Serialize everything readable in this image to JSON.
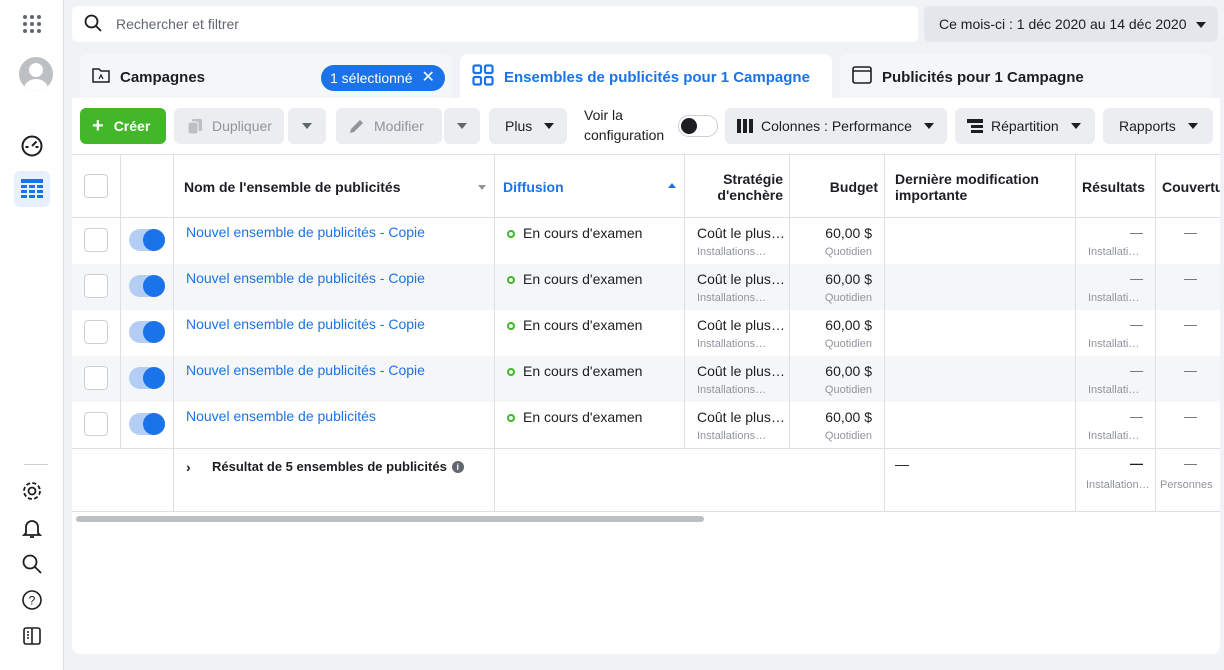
{
  "search": {
    "placeholder": "Rechercher et filtrer"
  },
  "date_range": {
    "label": "Ce mois-ci : 1 déc 2020 au 14 déc 2020"
  },
  "tabs": {
    "campagnes": {
      "label": "Campagnes",
      "badge": "1 sélectionné"
    },
    "ensembles": {
      "label": "Ensembles de publicités pour 1 Campagne"
    },
    "publicites": {
      "label": "Publicités pour 1 Campagne"
    }
  },
  "toolbar": {
    "create": "Créer",
    "duplicate": "Dupliquer",
    "modify": "Modifier",
    "more": "Plus",
    "view_config": "Voir la configuration",
    "columns": "Colonnes : Performance",
    "breakdown": "Répartition",
    "reports": "Rapports"
  },
  "table": {
    "headers": {
      "name": "Nom de l'ensemble de publicités",
      "diffusion": "Diffusion",
      "strategy": "Stratégie d'enchère",
      "budget": "Budget",
      "last_modified": "Dernière modification importante",
      "results": "Résultats",
      "reach": "Couvertu"
    },
    "rows": [
      {
        "name": "Nouvel ensemble de publicités - Copie",
        "status": "En cours d'examen",
        "strategy": "Coût le plus faible",
        "strategy_sub": "Installations de l'application",
        "budget": "60,00 $",
        "budget_sub": "Quotidien",
        "results": "—",
        "results_sub": "Installations de l'application",
        "reach": "—",
        "active": true
      },
      {
        "name": "Nouvel ensemble de publicités - Copie",
        "status": "En cours d'examen",
        "strategy": "Coût le plus faible",
        "strategy_sub": "Installations de l'application",
        "budget": "60,00 $",
        "budget_sub": "Quotidien",
        "results": "—",
        "results_sub": "Installations de l'application",
        "reach": "—",
        "active": true
      },
      {
        "name": "Nouvel ensemble de publicités - Copie",
        "status": "En cours d'examen",
        "strategy": "Coût le plus faible",
        "strategy_sub": "Installations de l'application",
        "budget": "60,00 $",
        "budget_sub": "Quotidien",
        "results": "—",
        "results_sub": "Installations de l'application",
        "reach": "—",
        "active": true
      },
      {
        "name": "Nouvel ensemble de publicités - Copie",
        "status": "En cours d'examen",
        "strategy": "Coût le plus faible",
        "strategy_sub": "Installations de l'application",
        "budget": "60,00 $",
        "budget_sub": "Quotidien",
        "results": "—",
        "results_sub": "Installations de l'application",
        "reach": "—",
        "active": true
      },
      {
        "name": "Nouvel ensemble de publicités",
        "status": "En cours d'examen",
        "strategy": "Coût le plus faible",
        "strategy_sub": "Installations de l'application",
        "budget": "60,00 $",
        "budget_sub": "Quotidien",
        "results": "—",
        "results_sub": "Installations de l'application",
        "reach": "—",
        "active": true
      }
    ],
    "summary": {
      "label": "Résultat de 5 ensembles de publicités",
      "last_modified": "—",
      "results": "—",
      "results_sub": "Installations de l'application",
      "reach": "—",
      "reach_sub": "Personnes"
    }
  },
  "colors": {
    "accent": "#1a73e8",
    "create": "#42b72a",
    "status_ok": "#42b72a"
  },
  "icons": [
    "apps-grid-icon",
    "avatar",
    "dashboard-icon",
    "table-icon",
    "gear-icon",
    "bell-icon",
    "search-icon",
    "help-icon",
    "panel-icon",
    "search-icon",
    "folder-icon",
    "grid-icon",
    "window-icon",
    "copy-icon",
    "pencil-icon",
    "columns-icon",
    "breakdown-icon",
    "info-icon"
  ]
}
